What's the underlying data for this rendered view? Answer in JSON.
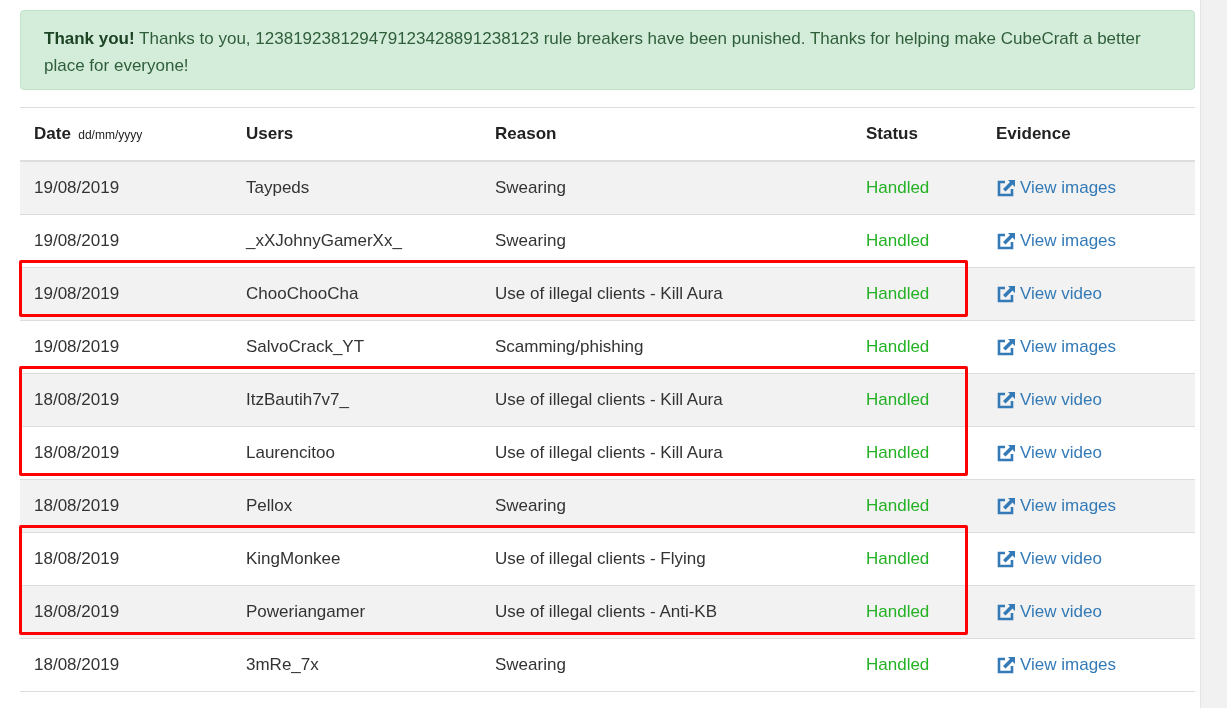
{
  "alert": {
    "text": "**Thank you!** Thanks to you, 123819238129479123428891238123 rule breakers have been punished. Thanks for helping make CubeCraft a better place for everyone!"
  },
  "table": {
    "columns": [
      {
        "label": "Date",
        "hint": "dd/mm/yyyy"
      },
      {
        "label": "Users"
      },
      {
        "label": "Reason"
      },
      {
        "label": "Status"
      },
      {
        "label": "Evidence"
      }
    ],
    "rows": [
      {
        "date": "19/08/2019",
        "user": "Taypeds",
        "reason": "Swearing",
        "status": "Handled",
        "evidence": "View images",
        "marked": false
      },
      {
        "date": "19/08/2019",
        "user": "_xXJohnyGamerXx_",
        "reason": "Swearing",
        "status": "Handled",
        "evidence": "View images",
        "marked": false
      },
      {
        "date": "19/08/2019",
        "user": "ChooChooCha",
        "reason": "Use of illegal clients - Kill Aura",
        "status": "Handled",
        "evidence": "View video",
        "marked": true
      },
      {
        "date": "19/08/2019",
        "user": "SalvoCrack_YT",
        "reason": "Scamming/phishing",
        "status": "Handled",
        "evidence": "View images",
        "marked": false
      },
      {
        "date": "18/08/2019",
        "user": "ItzBautih7v7_",
        "reason": "Use of illegal clients - Kill Aura",
        "status": "Handled",
        "evidence": "View video",
        "marked": true
      },
      {
        "date": "18/08/2019",
        "user": "Laurencitoo",
        "reason": "Use of illegal clients - Kill Aura",
        "status": "Handled",
        "evidence": "View video",
        "marked": true
      },
      {
        "date": "18/08/2019",
        "user": "Pellox",
        "reason": "Swearing",
        "status": "Handled",
        "evidence": "View images",
        "marked": false
      },
      {
        "date": "18/08/2019",
        "user": "KingMonkee",
        "reason": "Use of illegal clients - Flying",
        "status": "Handled",
        "evidence": "View video",
        "marked": true
      },
      {
        "date": "18/08/2019",
        "user": "Poweriangamer",
        "reason": "Use of illegal clients - Anti-KB",
        "status": "Handled",
        "evidence": "View video",
        "marked": true
      },
      {
        "date": "18/08/2019",
        "user": "3mRe_7x",
        "reason": "Swearing",
        "status": "Handled",
        "evidence": "View images",
        "marked": false
      }
    ]
  }
}
